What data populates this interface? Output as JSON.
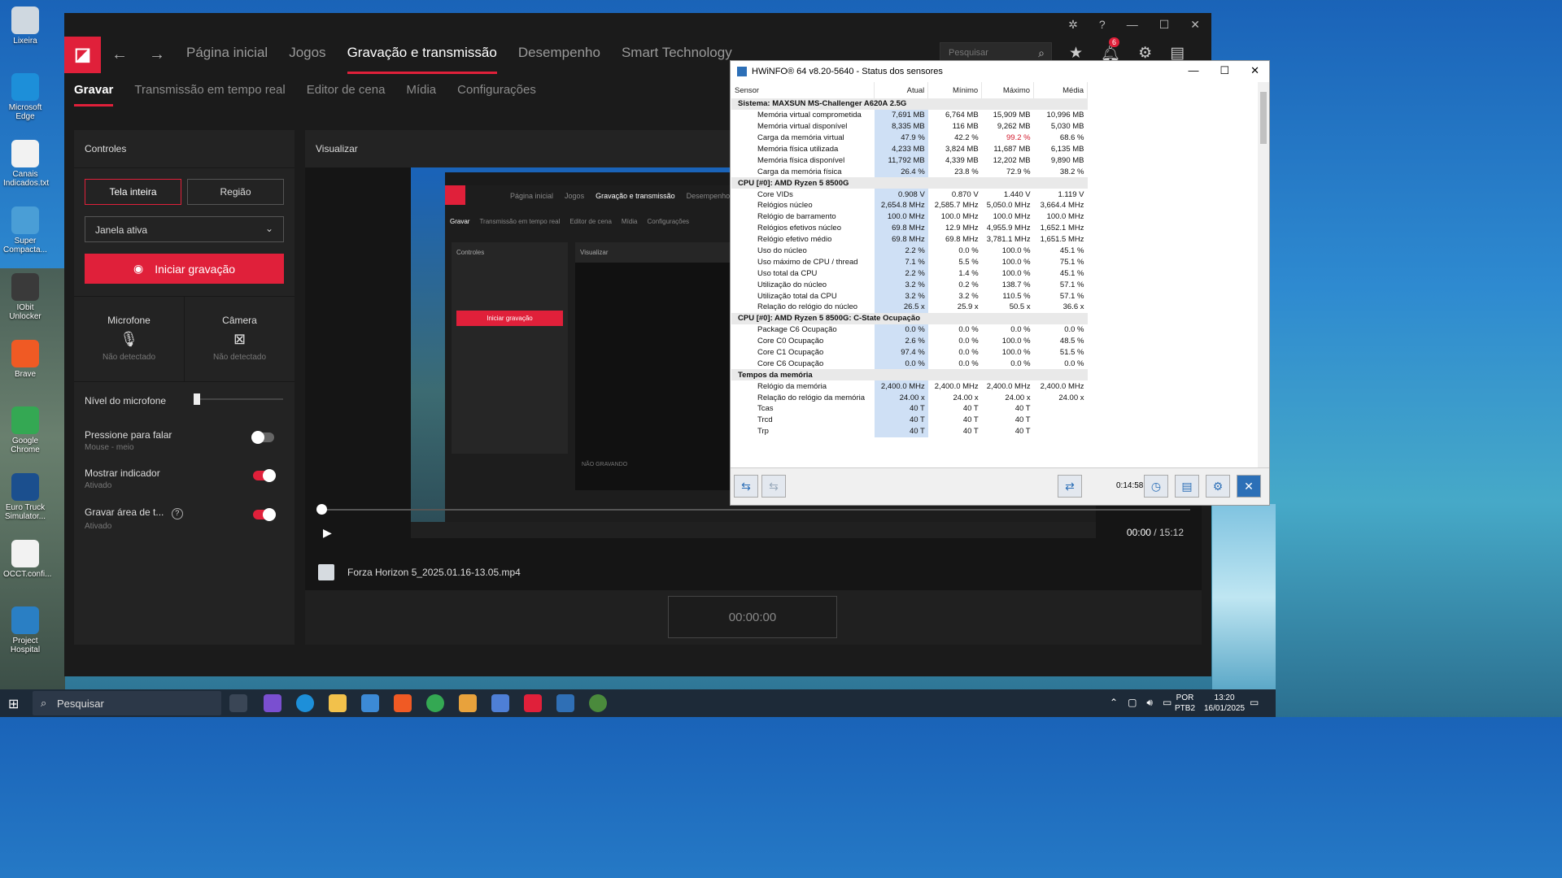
{
  "desktop": {
    "icons": [
      {
        "label": "Lixeira",
        "color": "#cfd8e0"
      },
      {
        "label": "Microsoft Edge",
        "color": "#1d8fd9"
      },
      {
        "label": "Canais Indicados.txt",
        "color": "#f2f2f2"
      },
      {
        "label": "Super Compacta...",
        "color": "#4a9ed6"
      },
      {
        "label": "IObit Unlocker",
        "color": "#3a3a3a"
      },
      {
        "label": "Brave",
        "color": "#f05a24"
      },
      {
        "label": "Google Chrome",
        "color": "#34a853"
      },
      {
        "label": "Euro Truck Simulator...",
        "color": "#1b4f8e"
      },
      {
        "label": "OCCT.confi...",
        "color": "#f2f2f2"
      },
      {
        "label": "Project Hospital",
        "color": "#2a7fc4"
      }
    ]
  },
  "amd": {
    "nav": {
      "items": [
        "Página inicial",
        "Jogos",
        "Gravação e transmissão",
        "Desempenho",
        "Smart Technology"
      ],
      "active": "Gravação e transmissão",
      "search_placeholder": "Pesquisar",
      "notifications_count": "6"
    },
    "subnav": [
      "Gravar",
      "Transmissão em tempo real",
      "Editor de cena",
      "Mídia",
      "Configurações"
    ],
    "controls": {
      "title": "Controles",
      "fullscreen": "Tela inteira",
      "region": "Região",
      "window_select": "Janela ativa",
      "record_button": "Iniciar gravação",
      "microphone_label": "Microfone",
      "microphone_status": "Não detectado",
      "camera_label": "Câmera",
      "camera_status": "Não detectado",
      "mic_level_label": "Nível do microfone",
      "mic_level_value": 0,
      "push_to_talk_label": "Pressione para falar",
      "push_to_talk_sub": "Mouse - meio",
      "push_to_talk_on": false,
      "show_indicator_label": "Mostrar indicador",
      "show_indicator_sub": "Ativado",
      "show_indicator_on": true,
      "record_area_label": "Gravar área de t...",
      "record_area_sub": "Ativado",
      "record_area_on": true
    },
    "preview": {
      "title": "Visualizar",
      "mini": {
        "nav": [
          "Página inicial",
          "Jogos",
          "Gravação e transmissão",
          "Desempenho"
        ],
        "subnav": [
          "Gravar",
          "Transmissão em tempo real",
          "Editor de cena",
          "Mídia",
          "Configurações"
        ],
        "controls": "Controles",
        "visualizar": "Visualizar",
        "record": "Iniciar gravação",
        "not_recording": "NÃO GRAVANDO"
      },
      "time_current": "00:00",
      "time_total": "/ 15:12",
      "progress": 0,
      "file_name": "Forza Horizon 5_2025.01.16-13.05.mp4",
      "timer": "00:00:00"
    }
  },
  "hwinfo": {
    "title": "HWiNFO® 64 v8.20-5640 - Status dos sensores",
    "columns": [
      "Sensor",
      "Atual",
      "Mínimo",
      "Máximo",
      "Média"
    ],
    "groups": [
      {
        "name": "Sistema: MAXSUN MS-Challenger A620A 2.5G",
        "rows": [
          [
            "Memória virtual comprometida",
            "7,691 MB",
            "6,764 MB",
            "15,909 MB",
            "10,996 MB"
          ],
          [
            "Memória virtual disponível",
            "8,335 MB",
            "116 MB",
            "9,262 MB",
            "5,030 MB"
          ],
          [
            "Carga da memória virtual",
            "47.9 %",
            "42.2 %",
            "99.2 %",
            "68.6 %"
          ],
          [
            "Memória física utilizada",
            "4,233 MB",
            "3,824 MB",
            "11,687 MB",
            "6,135 MB"
          ],
          [
            "Memória física disponível",
            "11,792 MB",
            "4,339 MB",
            "12,202 MB",
            "9,890 MB"
          ],
          [
            "Carga da memória física",
            "26.4 %",
            "23.8 %",
            "72.9 %",
            "38.2 %"
          ]
        ]
      },
      {
        "name": "CPU [#0]: AMD Ryzen 5 8500G",
        "rows": [
          [
            "Core VIDs",
            "0.908 V",
            "0.870 V",
            "1.440 V",
            "1.119 V"
          ],
          [
            "Relógios núcleo",
            "2,654.8 MHz",
            "2,585.7 MHz",
            "5,050.0 MHz",
            "3,664.4 MHz"
          ],
          [
            "Relógio de barramento",
            "100.0 MHz",
            "100.0 MHz",
            "100.0 MHz",
            "100.0 MHz"
          ],
          [
            "Relógios efetivos núcleo",
            "69.8 MHz",
            "12.9 MHz",
            "4,955.9 MHz",
            "1,652.1 MHz"
          ],
          [
            "Relógio efetivo médio",
            "69.8 MHz",
            "69.8 MHz",
            "3,781.1 MHz",
            "1,651.5 MHz"
          ],
          [
            "Uso do núcleo",
            "2.2 %",
            "0.0 %",
            "100.0 %",
            "45.1 %"
          ],
          [
            "Uso máximo de CPU / thread",
            "7.1 %",
            "5.5 %",
            "100.0 %",
            "75.1 %"
          ],
          [
            "Uso total da CPU",
            "2.2 %",
            "1.4 %",
            "100.0 %",
            "45.1 %"
          ],
          [
            "Utilização do núcleo",
            "3.2 %",
            "0.2 %",
            "138.7 %",
            "57.1 %"
          ],
          [
            "Utilização total da CPU",
            "3.2 %",
            "3.2 %",
            "110.5 %",
            "57.1 %"
          ],
          [
            "Relação do relógio do núcleo",
            "26.5 x",
            "25.9 x",
            "50.5 x",
            "36.6 x"
          ]
        ]
      },
      {
        "name": "CPU [#0]: AMD Ryzen 5 8500G: C-State Ocupação",
        "rows": [
          [
            "Package C6 Ocupação",
            "0.0 %",
            "0.0 %",
            "0.0 %",
            "0.0 %"
          ],
          [
            "Core C0 Ocupação",
            "2.6 %",
            "0.0 %",
            "100.0 %",
            "48.5 %"
          ],
          [
            "Core C1 Ocupação",
            "97.4 %",
            "0.0 %",
            "100.0 %",
            "51.5 %"
          ],
          [
            "Core C6 Ocupação",
            "0.0 %",
            "0.0 %",
            "0.0 %",
            "0.0 %"
          ]
        ]
      },
      {
        "name": "Tempos da memória",
        "rows": [
          [
            "Relógio da memória",
            "2,400.0 MHz",
            "2,400.0 MHz",
            "2,400.0 MHz",
            "2,400.0 MHz"
          ],
          [
            "Relação do relógio da memória",
            "24.00 x",
            "24.00 x",
            "24.00 x",
            "24.00 x"
          ],
          [
            "Tcas",
            "40 T",
            "40 T",
            "40 T",
            ""
          ],
          [
            "Trcd",
            "40 T",
            "40 T",
            "40 T",
            ""
          ],
          [
            "Trp",
            "40 T",
            "40 T",
            "40 T",
            ""
          ]
        ]
      }
    ],
    "elapsed": "0:14:58"
  },
  "taskbar": {
    "search_placeholder": "Pesquisar",
    "lang": "POR",
    "layout": "PTB2",
    "time": "13:20",
    "date": "16/01/2025"
  }
}
